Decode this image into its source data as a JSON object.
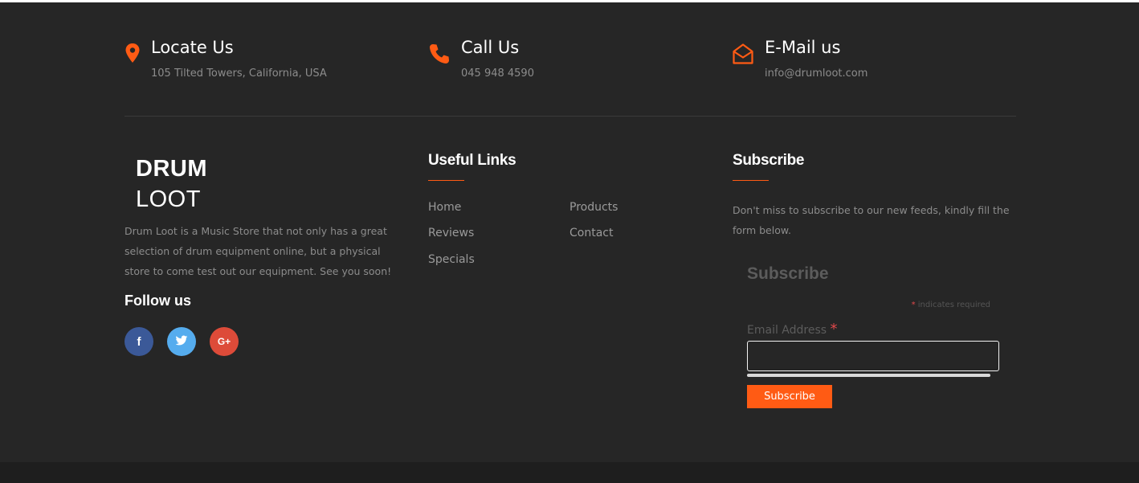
{
  "contacts": [
    {
      "title": "Locate Us",
      "value": "105 Tilted Towers, California, USA",
      "icon": "map-pin-icon"
    },
    {
      "title": "Call Us",
      "value": "045 948 4590",
      "icon": "phone-icon"
    },
    {
      "title": "E-Mail us",
      "value": "info@drumloot.com",
      "icon": "envelope-open-icon"
    }
  ],
  "about": {
    "logo_line1": "DRUM",
    "logo_line2": "LOOT",
    "description": "Drum Loot is a Music Store that not only has a great selection of drum equipment online, but a physical store to come test out our equipment. See you soon!",
    "follow_title": "Follow us",
    "social": [
      {
        "name": "facebook",
        "glyph": "f",
        "color": "#3b5998"
      },
      {
        "name": "twitter",
        "glyph": "t",
        "color": "#55acee"
      },
      {
        "name": "google-plus",
        "glyph": "G+",
        "color": "#dd4b39"
      }
    ]
  },
  "useful_links": {
    "title": "Useful Links",
    "links": [
      "Home",
      "Products",
      "Reviews",
      "Contact",
      "Specials"
    ]
  },
  "subscribe": {
    "title": "Subscribe",
    "description": "Don't miss to subscribe to our new feeds, kindly fill the form below.",
    "form_title": "Subscribe",
    "required_star": "*",
    "required_note": "indicates required",
    "email_label": "Email Address",
    "email_value": "",
    "button_label": "Subscribe"
  },
  "colors": {
    "accent": "#ff5b14",
    "background": "#262626",
    "text_muted": "#8c8c8c"
  }
}
